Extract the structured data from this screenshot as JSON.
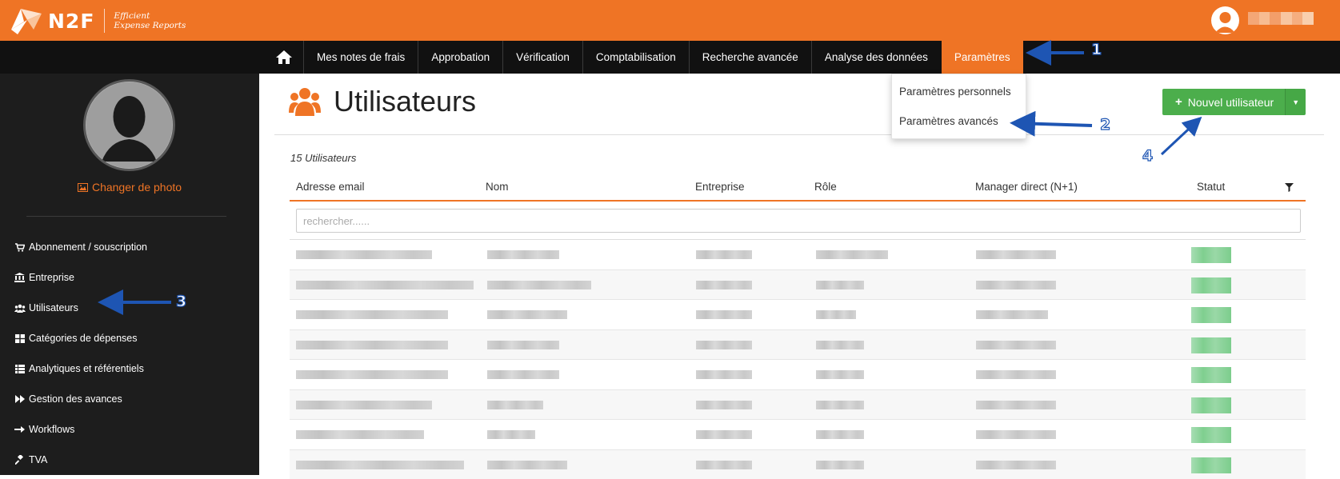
{
  "header": {
    "logo_text": "N2F",
    "tagline_line1": "Efficient",
    "tagline_line2": "Expense Reports",
    "brand_color": "#ef7425"
  },
  "nav": {
    "home_icon": "home-icon",
    "items": [
      {
        "label": "Mes notes de frais"
      },
      {
        "label": "Approbation"
      },
      {
        "label": "Vérification"
      },
      {
        "label": "Comptabilisation"
      },
      {
        "label": "Recherche avancée"
      },
      {
        "label": "Analyse des données"
      },
      {
        "label": "Paramètres",
        "active": true
      }
    ]
  },
  "dropdown": {
    "items": [
      {
        "label": "Paramètres personnels"
      },
      {
        "label": "Paramètres avancés"
      }
    ]
  },
  "sidebar": {
    "change_photo": "Changer de photo",
    "items": [
      {
        "label": "Abonnement / souscription",
        "icon": "cart-icon"
      },
      {
        "label": "Entreprise",
        "icon": "bank-icon"
      },
      {
        "label": "Utilisateurs",
        "icon": "users-icon"
      },
      {
        "label": "Catégories de dépenses",
        "icon": "grid-icon"
      },
      {
        "label": "Analytiques et référentiels",
        "icon": "list-icon"
      },
      {
        "label": "Gestion des avances",
        "icon": "fast-forward-icon"
      },
      {
        "label": "Workflows",
        "icon": "arrow-right-icon"
      },
      {
        "label": "TVA",
        "icon": "gavel-icon"
      }
    ]
  },
  "main": {
    "title": "Utilisateurs",
    "new_user_button": "Nouvel utilisateur",
    "count_text": "15 Utilisateurs",
    "search_placeholder": "rechercher......",
    "columns": [
      "Adresse email",
      "Nom",
      "Entreprise",
      "Rôle",
      "Manager direct (N+1)",
      "Statut"
    ],
    "success_color": "#4cae4c"
  },
  "annotations": [
    "1",
    "2",
    "3",
    "4"
  ]
}
